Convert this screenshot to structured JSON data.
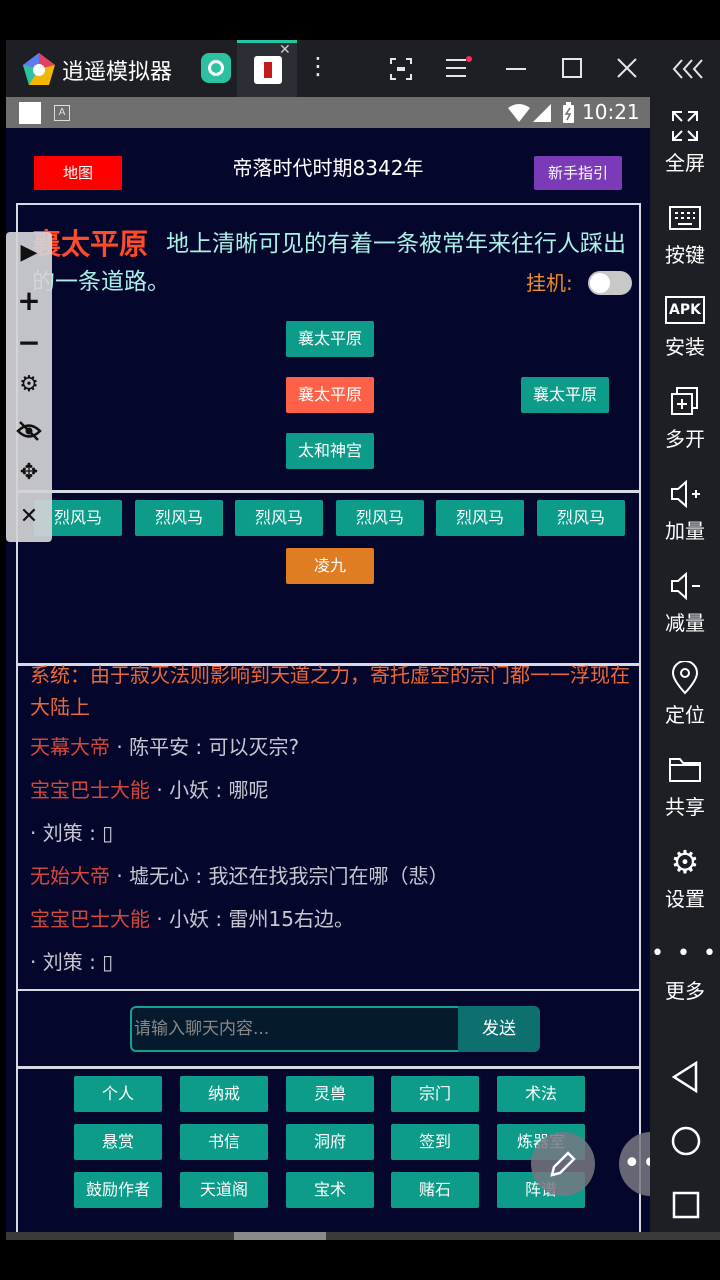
{
  "emulator": {
    "app_name": "逍遥模拟器",
    "sidebar": [
      {
        "icon": "fullscreen-icon",
        "label": "全屏"
      },
      {
        "icon": "keyboard-icon",
        "label": "按键"
      },
      {
        "icon": "apk-icon",
        "label": "安装"
      },
      {
        "icon": "multi-instance-icon",
        "label": "多开"
      },
      {
        "icon": "volume-up-icon",
        "label": "加量"
      },
      {
        "icon": "volume-down-icon",
        "label": "减量"
      },
      {
        "icon": "location-icon",
        "label": "定位"
      },
      {
        "icon": "folder-icon",
        "label": "共享"
      },
      {
        "icon": "gear-icon",
        "label": "设置"
      },
      {
        "icon": "more-icon",
        "label": "更多"
      }
    ],
    "apk_text": "APK"
  },
  "status_bar": {
    "time": "10:21"
  },
  "game": {
    "map_button": "地图",
    "era_title": "帝落时代时期8342年",
    "guide_button": "新手指引",
    "location": {
      "name": "襄太平原",
      "description": "地上清晰可见的有着一条被常年来往行人踩出的一条道路。"
    },
    "hang_label": "挂机:",
    "exits": {
      "north": "襄太平原",
      "current": "襄太平原",
      "east": "襄太平原",
      "south": "太和神宫"
    },
    "npcs": [
      "烈风马",
      "烈风马",
      "烈风马",
      "烈风马",
      "烈风马",
      "烈风马"
    ],
    "player": "凌九",
    "chat": [
      {
        "title": "",
        "name": "",
        "text": "系统：由于寂灭法则影响到天道之力，寄托虚空的宗门都一一浮现在大陆上",
        "system": true
      },
      {
        "title": "天幕大帝",
        "name": " · 陈平安 : ",
        "text": "可以灭宗?"
      },
      {
        "title": "宝宝巴士大能",
        "name": " · 小妖 : ",
        "text": "哪呢"
      },
      {
        "title": "",
        "name": " · 刘策 : ",
        "text": "▯"
      },
      {
        "title": "无始大帝",
        "name": " · 墟无心 : ",
        "text": "我还在找我宗门在哪（悲）"
      },
      {
        "title": "宝宝巴士大能",
        "name": " · 小妖 : ",
        "text": "雷州15右边。"
      },
      {
        "title": "",
        "name": " · 刘策 : ",
        "text": "▯"
      }
    ],
    "chat_placeholder": "请输入聊天内容...",
    "send_button": "发送",
    "menu": [
      [
        "个人",
        "纳戒",
        "灵兽",
        "宗门",
        "术法"
      ],
      [
        "悬赏",
        "书信",
        "洞府",
        "签到",
        "炼器室"
      ],
      [
        "鼓励作者",
        "天道阁",
        "宝术",
        "赌石",
        "阵谱"
      ]
    ]
  },
  "colors": {
    "game_bg": "#05062b",
    "teal_button": "#0d9c8a",
    "map_button": "#ff0000",
    "guide_button": "#7b3ab8"
  }
}
